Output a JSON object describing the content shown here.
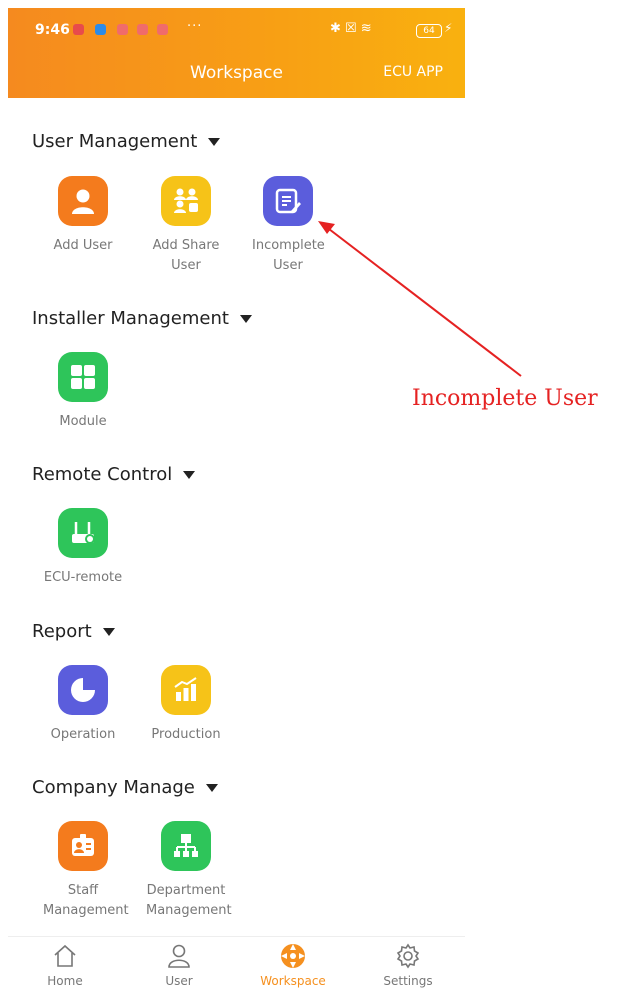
{
  "status_bar": {
    "time": "9:46",
    "battery": "64",
    "dots": "···"
  },
  "header": {
    "title": "Workspace",
    "right_action": "ECU APP"
  },
  "sections": [
    {
      "title": "User Management",
      "items": [
        {
          "label": "Add User",
          "icon": "user-icon",
          "color": "#f47b1d"
        },
        {
          "label": "Add Share User",
          "icon": "share-users-icon",
          "color": "#f6c318"
        },
        {
          "label": "Incomplete User",
          "icon": "edit-list-icon",
          "color": "#5b5ddc"
        }
      ]
    },
    {
      "title": "Installer Management",
      "items": [
        {
          "label": "Module",
          "icon": "grid-icon",
          "color": "#2ec55a"
        }
      ]
    },
    {
      "title": "Remote Control",
      "items": [
        {
          "label": "ECU-remote",
          "icon": "router-gear-icon",
          "color": "#2ec55a"
        }
      ]
    },
    {
      "title": "Report",
      "items": [
        {
          "label": "Operation",
          "icon": "pie-icon",
          "color": "#5b5ddc"
        },
        {
          "label": "Production",
          "icon": "bar-chart-icon",
          "color": "#f6c318"
        }
      ]
    },
    {
      "title": "Company Manage",
      "items": [
        {
          "label": "Staff Management",
          "icon": "badge-icon",
          "color": "#f47b1d"
        },
        {
          "label": "Department Management",
          "icon": "org-chart-icon",
          "color": "#2ec55a"
        }
      ]
    }
  ],
  "annotation": {
    "text": "Incomplete User",
    "color": "#e52222"
  },
  "bottom_nav": [
    {
      "label": "Home",
      "icon": "home-icon"
    },
    {
      "label": "User",
      "icon": "user-outline-icon"
    },
    {
      "label": "Workspace",
      "icon": "workspace-icon",
      "active": true
    },
    {
      "label": "Settings",
      "icon": "gear-icon"
    }
  ],
  "colors": {
    "accent": "#f5901f",
    "header_from": "#f58a1f",
    "header_to": "#f9b10f"
  }
}
